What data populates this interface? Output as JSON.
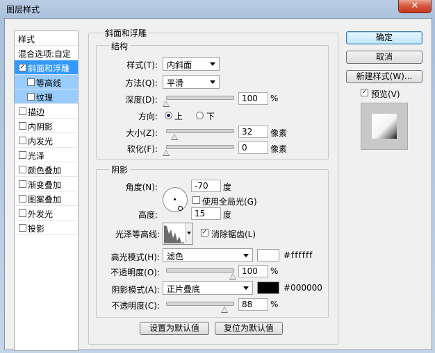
{
  "window": {
    "title": "图层样式",
    "close_glyph": "✕"
  },
  "left_panel": {
    "header": "样式",
    "blend_options": "混合选项:自定",
    "items": [
      {
        "label": "斜面和浮雕",
        "checked": true,
        "state": "selected"
      },
      {
        "label": "等高线",
        "checked": false,
        "state": "sub"
      },
      {
        "label": "纹理",
        "checked": false,
        "state": "sub"
      },
      {
        "label": "描边",
        "checked": false
      },
      {
        "label": "内阴影",
        "checked": false
      },
      {
        "label": "内发光",
        "checked": false
      },
      {
        "label": "光泽",
        "checked": false
      },
      {
        "label": "颜色叠加",
        "checked": false
      },
      {
        "label": "渐变叠加",
        "checked": false
      },
      {
        "label": "图案叠加",
        "checked": false
      },
      {
        "label": "外发光",
        "checked": false
      },
      {
        "label": "投影",
        "checked": false
      }
    ],
    "check_glyph": "✓"
  },
  "bevel": {
    "group_title": "斜面和浮雕",
    "structure": {
      "title": "结构",
      "style_label": "样式(T):",
      "style_value": "内斜面",
      "technique_label": "方法(Q):",
      "technique_value": "平滑",
      "depth_label": "深度(D):",
      "depth_value": "100",
      "depth_fraction": 0.0,
      "depth_unit": "%",
      "direction_label": "方向:",
      "dir_up": "上",
      "dir_down": "下",
      "direction_selected": "上",
      "size_label": "大小(Z):",
      "size_value": "32",
      "size_fraction": 0.13,
      "size_unit": "像素",
      "soften_label": "软化(F):",
      "soften_value": "0",
      "soften_fraction": 0.0,
      "soften_unit": "像素"
    },
    "shading": {
      "title": "阴影",
      "angle_label": "角度(N):",
      "angle_value": "-70",
      "angle_unit": "度",
      "global_light_label": "使用全局光(G)",
      "global_light_checked": false,
      "altitude_label": "高度:",
      "altitude_value": "15",
      "altitude_unit": "度",
      "gloss_label": "光泽等高线:",
      "antialias_label": "消除锯齿(L)",
      "antialias_checked": true,
      "highlight_mode_label": "高光模式(H):",
      "highlight_mode_value": "滤色",
      "highlight_color": "#ffffff",
      "highlight_color_text": "#ffffff",
      "highlight_opacity_label": "不透明度(O):",
      "highlight_opacity_value": "100",
      "highlight_opacity_fraction": 1.0,
      "highlight_opacity_unit": "%",
      "shadow_mode_label": "阴影模式(A):",
      "shadow_mode_value": "正片叠底",
      "shadow_color": "#000000",
      "shadow_color_text": "#000000",
      "shadow_opacity_label": "不透明度(C):",
      "shadow_opacity_value": "88",
      "shadow_opacity_fraction": 0.88,
      "shadow_opacity_unit": "%"
    },
    "make_default": "设置为默认值",
    "reset_default": "复位为默认值"
  },
  "right_panel": {
    "ok": "确定",
    "cancel": "取消",
    "new_style": "新建样式(W)...",
    "preview_label": "预览(V)",
    "preview_checked": true
  }
}
